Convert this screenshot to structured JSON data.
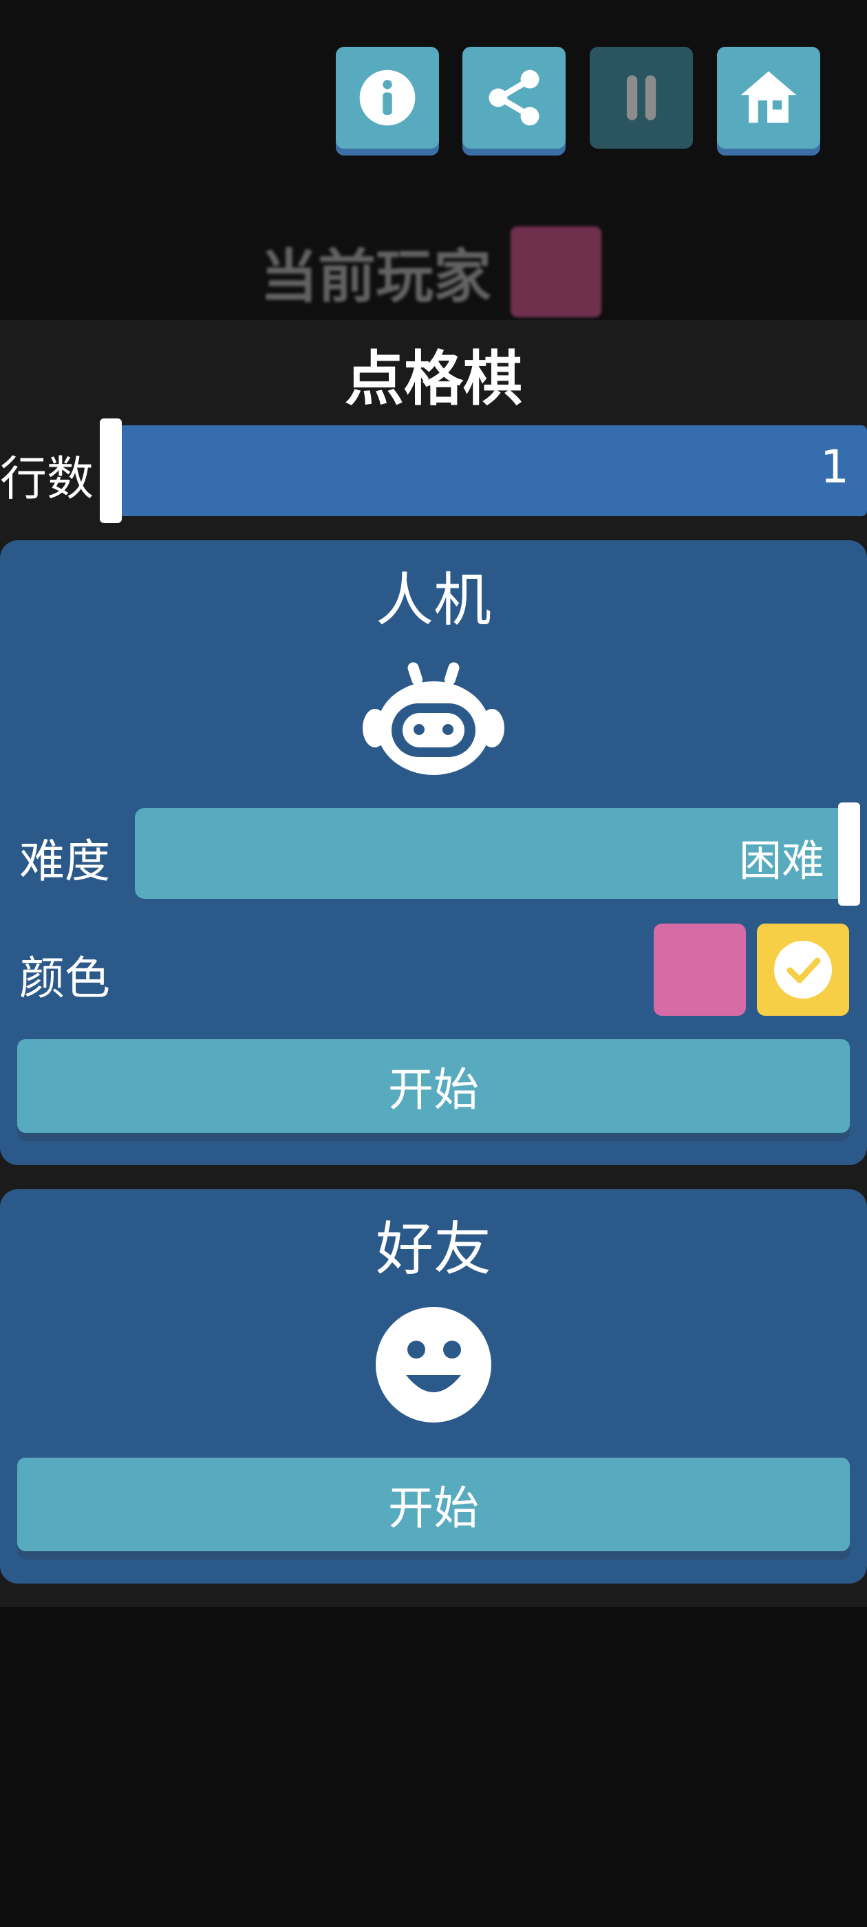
{
  "toolbar": {
    "info_icon": "info-icon",
    "share_icon": "share-icon",
    "pause_icon": "pause-icon",
    "home_icon": "home-icon"
  },
  "status": {
    "current_player_label": "当前玩家",
    "current_player_color": "#b04777"
  },
  "game": {
    "title": "点格棋",
    "rows_label": "行数",
    "rows_value": "1"
  },
  "ai_mode": {
    "title": "人机",
    "icon": "robot-icon",
    "difficulty_label": "难度",
    "difficulty_value": "困难",
    "color_label": "颜色",
    "colors": [
      "#d66ba8",
      "#f6cf47"
    ],
    "selected_color": "#f6cf47",
    "start_label": "开始"
  },
  "friend_mode": {
    "title": "好友",
    "icon": "smiley-face-icon",
    "start_label": "开始"
  }
}
